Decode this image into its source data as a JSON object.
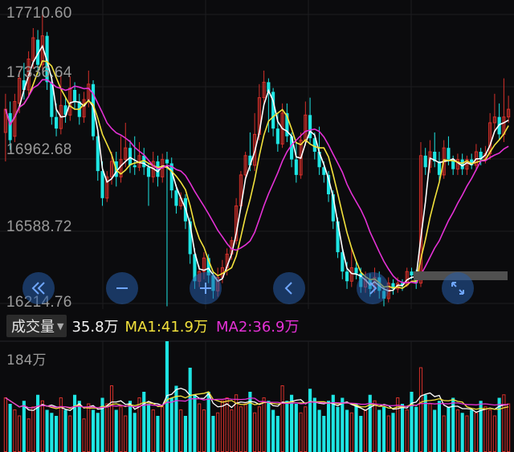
{
  "price_axis": {
    "labels": [
      "17710.60",
      "17336.64",
      "16962.68",
      "16588.72",
      "16214.76"
    ]
  },
  "volume_panel": {
    "selector_label": "成交量",
    "value": "35.8万",
    "ma1": "MA1:41.9万",
    "ma2": "MA2:36.9万",
    "max_label": "184万"
  },
  "colors": {
    "up": "#d6302a",
    "down": "#1ee5e3",
    "ma_short": "#ffffff",
    "ma1": "#f3e23c",
    "ma2": "#e531d6"
  },
  "controls": [
    {
      "name": "scroll-left-fast-button",
      "icon": "double-chevron-left-icon"
    },
    {
      "name": "zoom-out-button",
      "icon": "minus-icon"
    },
    {
      "name": "zoom-in-button",
      "icon": "plus-icon"
    },
    {
      "name": "scroll-left-button",
      "icon": "chevron-left-icon"
    },
    {
      "name": "scroll-right-button",
      "icon": "chevron-right-icon"
    },
    {
      "name": "fullscreen-button",
      "icon": "expand-icon"
    }
  ],
  "chart_data": {
    "type": "candlestick",
    "y_ticks": [
      17710.6,
      17336.64,
      16962.68,
      16588.72,
      16214.76
    ],
    "candles": [
      [
        17100,
        17220,
        16950,
        17300
      ],
      [
        17200,
        17060,
        17010,
        17260
      ],
      [
        17080,
        17260,
        17050,
        17300
      ],
      [
        17250,
        17380,
        17200,
        17420
      ],
      [
        17370,
        17320,
        17270,
        17460
      ],
      [
        17320,
        17480,
        17280,
        17520
      ],
      [
        17470,
        17590,
        17430,
        17640
      ],
      [
        17580,
        17450,
        17400,
        17630
      ],
      [
        17450,
        17600,
        17420,
        17710
      ],
      [
        17600,
        17360,
        17320,
        17620
      ],
      [
        17360,
        17180,
        17140,
        17400
      ],
      [
        17180,
        17120,
        17080,
        17250
      ],
      [
        17120,
        17240,
        17090,
        17400
      ],
      [
        17240,
        17190,
        17150,
        17280
      ],
      [
        17190,
        17330,
        17160,
        17390
      ],
      [
        17320,
        17260,
        17220,
        17360
      ],
      [
        17260,
        17180,
        17140,
        17300
      ],
      [
        17180,
        17270,
        17150,
        17310
      ],
      [
        17270,
        17350,
        17230,
        17420
      ],
      [
        17350,
        17080,
        17060,
        17370
      ],
      [
        17080,
        16900,
        16850,
        17100
      ],
      [
        16900,
        16760,
        16720,
        16950
      ],
      [
        16760,
        16870,
        16740,
        16900
      ],
      [
        16870,
        16950,
        16830,
        17000
      ],
      [
        16950,
        16870,
        16820,
        17000
      ],
      [
        16870,
        16960,
        16840,
        17080
      ],
      [
        16960,
        17020,
        16920,
        17150
      ],
      [
        17020,
        16930,
        16890,
        17060
      ],
      [
        16930,
        16920,
        16880,
        17080
      ],
      [
        16920,
        16980,
        16900,
        17050
      ],
      [
        16980,
        16920,
        16880,
        17020
      ],
      [
        16920,
        16870,
        16720,
        16940
      ],
      [
        16870,
        16950,
        16840,
        17000
      ],
      [
        16950,
        16870,
        16820,
        16980
      ],
      [
        16870,
        16960,
        16840,
        16990
      ],
      [
        16960,
        16940,
        16200,
        17000
      ],
      [
        16940,
        16800,
        16760,
        16970
      ],
      [
        16800,
        16720,
        16680,
        16830
      ],
      [
        16720,
        16760,
        16700,
        16790
      ],
      [
        16760,
        16640,
        16600,
        16780
      ],
      [
        16640,
        16470,
        16420,
        16660
      ],
      [
        16470,
        16330,
        16290,
        16500
      ],
      [
        16330,
        16380,
        16300,
        16410
      ],
      [
        16380,
        16450,
        16340,
        16480
      ],
      [
        16450,
        16360,
        16320,
        16470
      ],
      [
        16360,
        16280,
        16240,
        16380
      ],
      [
        16280,
        16350,
        16250,
        16400
      ],
      [
        16350,
        16400,
        16320,
        16440
      ],
      [
        16400,
        16470,
        16360,
        16500
      ],
      [
        16470,
        16540,
        16440,
        16560
      ],
      [
        16540,
        16720,
        16520,
        16760
      ],
      [
        16720,
        16880,
        16700,
        16900
      ],
      [
        16880,
        16980,
        16850,
        17000
      ],
      [
        16980,
        16930,
        16900,
        17100
      ],
      [
        16930,
        17090,
        16900,
        17200
      ],
      [
        17090,
        17280,
        17060,
        17350
      ],
      [
        17280,
        17360,
        17250,
        17420
      ],
      [
        17360,
        17310,
        17100,
        17380
      ],
      [
        17310,
        17120,
        17080,
        17330
      ],
      [
        17120,
        17040,
        17000,
        17200
      ],
      [
        17040,
        17200,
        17020,
        17250
      ],
      [
        17200,
        17080,
        17050,
        17250
      ],
      [
        17080,
        16960,
        16920,
        17100
      ],
      [
        16960,
        16880,
        16840,
        17050
      ],
      [
        16880,
        17060,
        16860,
        17100
      ],
      [
        17060,
        17190,
        17030,
        17260
      ],
      [
        17190,
        17070,
        17040,
        17280
      ],
      [
        17070,
        17000,
        16960,
        17100
      ],
      [
        17000,
        16920,
        16880,
        17130
      ],
      [
        16920,
        16880,
        16840,
        16950
      ],
      [
        16880,
        16780,
        16740,
        16900
      ],
      [
        16780,
        16640,
        16600,
        16800
      ],
      [
        16640,
        16480,
        16450,
        16660
      ],
      [
        16480,
        16380,
        16340,
        16500
      ],
      [
        16380,
        16330,
        16290,
        16430
      ],
      [
        16330,
        16400,
        16300,
        16500
      ],
      [
        16400,
        16370,
        16340,
        16430
      ],
      [
        16370,
        16300,
        16270,
        16400
      ],
      [
        16300,
        16340,
        16270,
        16380
      ],
      [
        16340,
        16290,
        16250,
        16370
      ],
      [
        16290,
        16350,
        16270,
        16400
      ],
      [
        16350,
        16280,
        16240,
        16380
      ],
      [
        16280,
        16240,
        16200,
        16300
      ],
      [
        16240,
        16320,
        16220,
        16350
      ],
      [
        16320,
        16290,
        16260,
        16340
      ],
      [
        16290,
        16320,
        16270,
        16350
      ],
      [
        16320,
        16310,
        16280,
        16340
      ],
      [
        16310,
        16380,
        16300,
        16400
      ],
      [
        16380,
        16360,
        16340,
        16400
      ],
      [
        16360,
        16320,
        16290,
        16390
      ],
      [
        16320,
        16980,
        16300,
        17050
      ],
      [
        16980,
        16920,
        16880,
        17020
      ],
      [
        16920,
        17000,
        16890,
        17060
      ],
      [
        17000,
        16950,
        16920,
        17100
      ],
      [
        16950,
        16880,
        16850,
        17000
      ],
      [
        16880,
        17020,
        16860,
        17060
      ],
      [
        17020,
        16960,
        16930,
        17080
      ],
      [
        16960,
        16910,
        16880,
        16980
      ],
      [
        16910,
        16960,
        16880,
        16990
      ],
      [
        16960,
        16910,
        16880,
        16990
      ],
      [
        16910,
        16960,
        16880,
        16980
      ],
      [
        16960,
        16930,
        16910,
        16990
      ],
      [
        16930,
        17000,
        16900,
        17040
      ],
      [
        17000,
        16960,
        16930,
        17020
      ],
      [
        16960,
        16990,
        16940,
        17030
      ],
      [
        16990,
        17150,
        16960,
        17200
      ],
      [
        17150,
        17180,
        17100,
        17300
      ],
      [
        17180,
        17090,
        17060,
        17250
      ],
      [
        17090,
        17180,
        17050,
        17380
      ],
      [
        17180,
        17220,
        17150,
        17290
      ]
    ],
    "volume": {
      "max": 184,
      "values": [
        90,
        80,
        70,
        60,
        85,
        55,
        75,
        95,
        85,
        70,
        65,
        60,
        90,
        70,
        60,
        95,
        85,
        55,
        80,
        70,
        65,
        90,
        80,
        110,
        70,
        75,
        60,
        85,
        65,
        90,
        100,
        80,
        70,
        60,
        75,
        184,
        90,
        110,
        70,
        60,
        140,
        95,
        80,
        70,
        100,
        60,
        65,
        85,
        90,
        70,
        95,
        75,
        80,
        100,
        65,
        75,
        90,
        85,
        70,
        60,
        110,
        85,
        95,
        80,
        65,
        75,
        105,
        90,
        70,
        60,
        85,
        95,
        75,
        90,
        70,
        65,
        80,
        60,
        70,
        95,
        85,
        70,
        75,
        60,
        65,
        90,
        80,
        70,
        100,
        75,
        140,
        95,
        80,
        70,
        85,
        60,
        75,
        90,
        70,
        65,
        60,
        70,
        65,
        85,
        75,
        70,
        60,
        90,
        95,
        80
      ]
    }
  }
}
